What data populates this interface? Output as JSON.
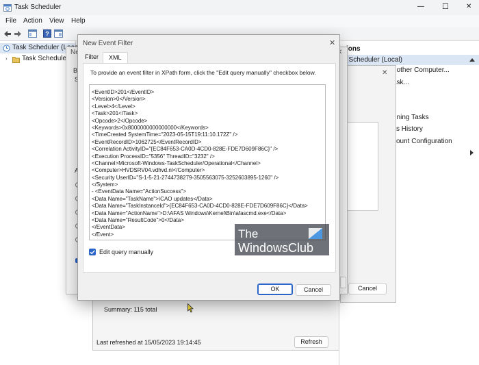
{
  "app": {
    "title": "Task Scheduler"
  },
  "menu": [
    "File",
    "Action",
    "View",
    "Help"
  ],
  "window_controls": {
    "minimize": "—",
    "maximize": "☐",
    "close": "✕"
  },
  "tree": {
    "root": "Task Scheduler (Loca",
    "library": "Task Schedule"
  },
  "background_dialog": {
    "title_fragment": "Ne",
    "labels": [
      "Be",
      "S",
      "A"
    ],
    "close_glyph": "✕"
  },
  "actions_pane": {
    "header": "ions",
    "selected": ": Scheduler (Local)",
    "items": [
      "nother Computer...",
      "ask...",
      "nning Tasks",
      "ks History",
      "count Configuration"
    ],
    "second_dialog_close": "✕",
    "cancel_label": "Cancel"
  },
  "status": {
    "summary": "Summary: 115 total",
    "last_refreshed": "Last refreshed at 15/05/2023 19:14:45",
    "refresh_label": "Refresh"
  },
  "dialog": {
    "title": "New Event Filter",
    "close_glyph": "✕",
    "tabs": [
      "Filter",
      "XML"
    ],
    "active_tab": "XML",
    "instruction": "To provide an event filter in XPath form, click the \"Edit query manually\" checkbox below.",
    "xml_lines": [
      "<EventID>201</EventID>",
      "<Version>0</Version>",
      "<Level>4</Level>",
      "<Task>201</Task>",
      "<Opcode>2</Opcode>",
      "<Keywords>0x8000000000000000</Keywords>",
      "<TimeCreated SystemTime=\"2023-05-15T19:11:10.172Z\" />",
      "<EventRecordID>1062725</EventRecordID>",
      "<Correlation ActivityID=\"{EC84F653-CA0D-4CD0-828E-FDE7D609F86C}\" />",
      "<Execution ProcessID=\"5356\" ThreadID=\"3232\" />",
      "<Channel>Microsoft-Windows-TaskScheduler/Operational</Channel>",
      "<Computer>HVDSRV04.vdhvd.nl</Computer>",
      "<Security UserID=\"S-1-5-21-2744738279-3505563075-3252603895-1260\" />",
      "</System>",
      "- <EventData Name=\"ActionSuccess\">",
      "<Data Name=\"TaskName\">\\CAO updates</Data>",
      "<Data Name=\"TaskInstanceId\">{EC84F653-CA0D-4CD0-828E-FDE7D609F86C}</Data>",
      "<Data Name=\"ActionName\">D:\\AFAS Windows\\Kernel\\Bin\\afascmd.exe</Data>",
      "<Data Name=\"ResultCode\">0</Data>",
      "</EventData>",
      "</Event>"
    ],
    "checkbox_label": "Edit query manually",
    "checkbox_checked": true,
    "ok_label": "OK",
    "cancel_label": "Cancel"
  },
  "watermark": {
    "line1": "The",
    "line2": "WindowsClub"
  },
  "colors": {
    "accent": "#2c65c8",
    "selection": "#dbe6f5"
  }
}
